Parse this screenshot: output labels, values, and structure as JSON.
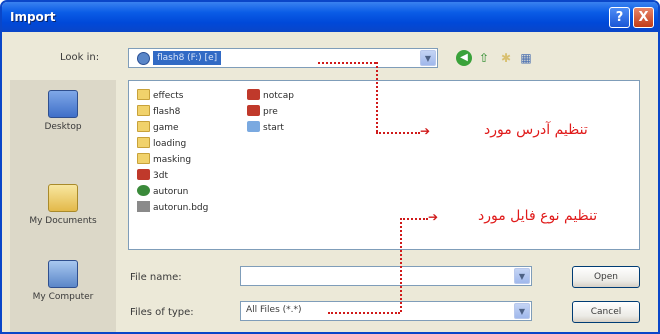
{
  "window": {
    "title": "Import",
    "help_label": "?",
    "close_label": "X"
  },
  "toolbar": {
    "lookin_label": "Look in:",
    "lookin_value": "flash8 (F:) [e]",
    "back_icon": "back-arrow-icon",
    "up_icon": "up-folder-icon",
    "new_folder_icon": "new-folder-icon",
    "views_icon": "views-menu-icon"
  },
  "places": [
    {
      "label": "Desktop",
      "icon": "desktop-icon"
    },
    {
      "label": "My Documents",
      "icon": "my-documents-icon"
    },
    {
      "label": "My Computer",
      "icon": "my-computer-icon"
    }
  ],
  "files": [
    {
      "name": "effects",
      "type": "folder"
    },
    {
      "name": "flash8",
      "type": "folder"
    },
    {
      "name": "game",
      "type": "folder"
    },
    {
      "name": "loading",
      "type": "folder"
    },
    {
      "name": "masking",
      "type": "folder"
    },
    {
      "name": "3dt",
      "type": "swf"
    },
    {
      "name": "autorun",
      "type": "app"
    },
    {
      "name": "autorun.bdg",
      "type": "doc"
    },
    {
      "name": "notcap",
      "type": "swf"
    },
    {
      "name": "pre",
      "type": "swf"
    },
    {
      "name": "start",
      "type": "exe"
    }
  ],
  "form": {
    "file_name_label": "File name:",
    "file_name_value": "",
    "files_type_label": "Files of type:",
    "files_type_value": "All Files (*.*)",
    "open_label": "Open",
    "cancel_label": "Cancel"
  },
  "annotations": {
    "address": "تنظیم آدرس مورد",
    "file_type": "تنظیم نوع فایل مورد"
  },
  "colors": {
    "titlebar": "#0a5ce6",
    "annotation": "#e01a1a",
    "dialog_bg": "#ece9d8"
  }
}
